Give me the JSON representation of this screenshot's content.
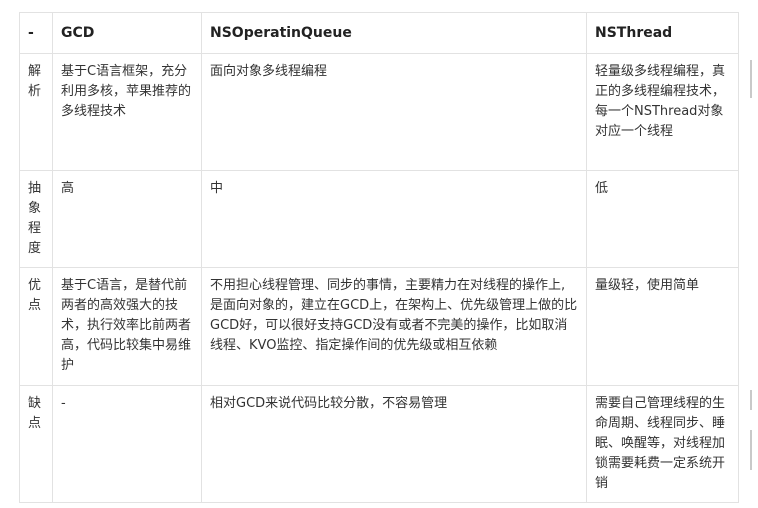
{
  "table": {
    "headers": [
      "-",
      "GCD",
      "NSOperatinQueue",
      "NSThread"
    ],
    "rows": [
      {
        "label": "解析",
        "cells": [
          "基于C语言框架，充分利用多核，苹果推荐的多线程技术",
          "面向对象多线程编程",
          "轻量级多线程编程，真正的多线程编程技术，每一个NSThread对象对应一个线程"
        ]
      },
      {
        "label": "抽象程度",
        "cells": [
          "高",
          "中",
          "低"
        ]
      },
      {
        "label": "优点",
        "cells": [
          "基于C语言，是替代前两者的高效强大的技术，执行效率比前两者高，代码比较集中易维护",
          "不用担心线程管理、同步的事情，主要精力在对线程的操作上,是面向对象的，建立在GCD上，在架构上、优先级管理上做的比GCD好，可以很好支持GCD没有或者不完美的操作，比如取消线程、KVO监控、指定操作间的优先级或相互依赖",
          "量级轻，使用简单"
        ]
      },
      {
        "label": "缺点",
        "cells": [
          "-",
          "相对GCD来说代码比较分散，不容易管理",
          "需要自己管理线程的生命周期、线程同步、睡眠、唤醒等，对线程加锁需要耗费一定系统开销"
        ]
      }
    ]
  }
}
